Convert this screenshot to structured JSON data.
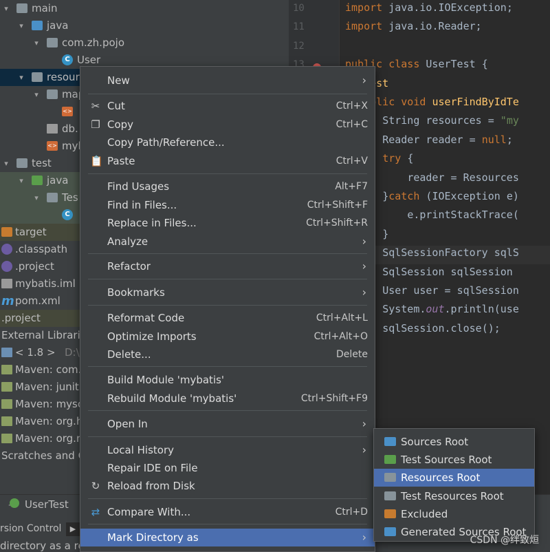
{
  "tree": [
    {
      "label": "main",
      "icon": "folder-icon",
      "arrow": "▾"
    },
    {
      "label": "java",
      "icon": "source-folder-icon",
      "arrow": "▾"
    },
    {
      "label": "com.zh.pojo",
      "icon": "package-icon",
      "arrow": "▾"
    },
    {
      "label": "User",
      "icon": "class-icon",
      "arrow": ""
    },
    {
      "label": "resour",
      "icon": "resources-folder-icon",
      "arrow": "▾"
    },
    {
      "label": "map",
      "icon": "folder-icon",
      "arrow": "▾"
    },
    {
      "label": "",
      "icon": "xml-file-icon",
      "arrow": ""
    },
    {
      "label": "db.",
      "icon": "properties-file-icon",
      "arrow": ""
    },
    {
      "label": "myb",
      "icon": "xml-file-icon",
      "arrow": ""
    },
    {
      "label": "test",
      "icon": "folder-icon",
      "arrow": "▾"
    },
    {
      "label": "java",
      "icon": "test-source-folder-icon",
      "arrow": "▾"
    },
    {
      "label": "Tes",
      "icon": "package-icon",
      "arrow": "▾"
    },
    {
      "label": "",
      "icon": "class-icon",
      "arrow": ""
    },
    {
      "label": "target",
      "icon": "excluded-folder-icon",
      "arrow": ""
    },
    {
      "label": ".classpath",
      "icon": "eclipse-icon",
      "arrow": ""
    },
    {
      "label": ".project",
      "icon": "eclipse-icon",
      "arrow": ""
    },
    {
      "label": "mybatis.iml",
      "icon": "iml-file-icon",
      "arrow": ""
    },
    {
      "label": "pom.xml",
      "icon": "maven-m-icon",
      "arrow": ""
    },
    {
      "label": ".project",
      "icon": "",
      "arrow": ""
    },
    {
      "label": "External Librarie",
      "icon": "",
      "arrow": ""
    },
    {
      "label": "< 1.8 >",
      "hint": "D:\\Pr",
      "icon": "jdk-icon",
      "arrow": ""
    },
    {
      "label": "Maven: com.",
      "icon": "library-icon",
      "arrow": ""
    },
    {
      "label": "Maven: junit:",
      "icon": "library-icon",
      "arrow": ""
    },
    {
      "label": "Maven: mysc",
      "icon": "library-icon",
      "arrow": ""
    },
    {
      "label": "Maven: org.h",
      "icon": "library-icon",
      "arrow": ""
    },
    {
      "label": "Maven: org.n",
      "icon": "library-icon",
      "arrow": ""
    },
    {
      "label": "Scratches and C",
      "icon": "",
      "arrow": ""
    }
  ],
  "editor": {
    "line_numbers": [
      "10",
      "11",
      "12",
      "13"
    ],
    "lines": [
      "import java.io.IOException;",
      "import java.io.Reader;",
      "",
      "public class UserTest {",
      "  @Test",
      "  public void userFindByIdTe",
      "      String resources = \"my",
      "      Reader reader = null;",
      "      try {",
      "          reader = Resources",
      "      }catch (IOException e)",
      "          e.printStackTrace(",
      "      }",
      "      SqlSessionFactory sqlS",
      "      SqlSession sqlSession",
      "      User user = sqlSession",
      "      System.out.println(use",
      "      sqlSession.close();"
    ]
  },
  "bottom": {
    "tab_label": "UserTest",
    "version_control": "rsion Control",
    "status": "directory as a res"
  },
  "menu": {
    "items": [
      {
        "label": "New",
        "shortcut": "",
        "submenu": true,
        "icon": ""
      },
      {
        "label": "Cut",
        "shortcut": "Ctrl+X",
        "submenu": false,
        "icon": "cut-icon"
      },
      {
        "label": "Copy",
        "shortcut": "Ctrl+C",
        "submenu": false,
        "icon": "copy-icon"
      },
      {
        "label": "Copy Path/Reference...",
        "shortcut": "",
        "submenu": false,
        "icon": ""
      },
      {
        "label": "Paste",
        "shortcut": "Ctrl+V",
        "submenu": false,
        "icon": "paste-icon"
      },
      {
        "label": "Find Usages",
        "shortcut": "Alt+F7",
        "submenu": false,
        "icon": ""
      },
      {
        "label": "Find in Files...",
        "shortcut": "Ctrl+Shift+F",
        "submenu": false,
        "icon": ""
      },
      {
        "label": "Replace in Files...",
        "shortcut": "Ctrl+Shift+R",
        "submenu": false,
        "icon": ""
      },
      {
        "label": "Analyze",
        "shortcut": "",
        "submenu": true,
        "icon": ""
      },
      {
        "label": "Refactor",
        "shortcut": "",
        "submenu": true,
        "icon": ""
      },
      {
        "label": "Bookmarks",
        "shortcut": "",
        "submenu": true,
        "icon": ""
      },
      {
        "label": "Reformat Code",
        "shortcut": "Ctrl+Alt+L",
        "submenu": false,
        "icon": ""
      },
      {
        "label": "Optimize Imports",
        "shortcut": "Ctrl+Alt+O",
        "submenu": false,
        "icon": ""
      },
      {
        "label": "Delete...",
        "shortcut": "Delete",
        "submenu": false,
        "icon": ""
      },
      {
        "label": "Build Module 'mybatis'",
        "shortcut": "",
        "submenu": false,
        "icon": ""
      },
      {
        "label": "Rebuild Module 'mybatis'",
        "shortcut": "Ctrl+Shift+F9",
        "submenu": false,
        "icon": ""
      },
      {
        "label": "Open In",
        "shortcut": "",
        "submenu": true,
        "icon": ""
      },
      {
        "label": "Local History",
        "shortcut": "",
        "submenu": true,
        "icon": ""
      },
      {
        "label": "Repair IDE on File",
        "shortcut": "",
        "submenu": false,
        "icon": ""
      },
      {
        "label": "Reload from Disk",
        "shortcut": "",
        "submenu": false,
        "icon": "reload-icon"
      },
      {
        "label": "Compare With...",
        "shortcut": "Ctrl+D",
        "submenu": false,
        "icon": "compare-icon"
      },
      {
        "label": "Mark Directory as",
        "shortcut": "",
        "submenu": true,
        "icon": "",
        "active": true
      }
    ]
  },
  "submenu": {
    "items": [
      {
        "label": "Sources Root",
        "icon": "sources-root-icon",
        "color": "#4a90c8"
      },
      {
        "label": "Test Sources Root",
        "icon": "test-sources-root-icon",
        "color": "#5a9e4b"
      },
      {
        "label": "Resources Root",
        "icon": "resources-root-icon",
        "color": "#87939a",
        "active": true
      },
      {
        "label": "Test Resources Root",
        "icon": "test-resources-root-icon",
        "color": "#87939a"
      },
      {
        "label": "Excluded",
        "icon": "excluded-icon",
        "color": "#c77b2f"
      },
      {
        "label": "Generated Sources Root",
        "icon": "generated-sources-root-icon",
        "color": "#4a90c8"
      }
    ]
  },
  "watermark": "CSDN @绊致烜",
  "colors": {
    "menu_bg": "#3c3f41",
    "selection": "#4b6eaf",
    "keyword": "#cc7832",
    "function": "#ffc66d",
    "string": "#6a8759"
  }
}
